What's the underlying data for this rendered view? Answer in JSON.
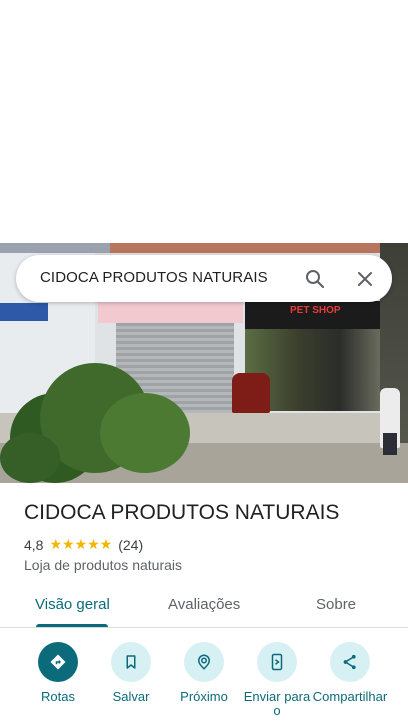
{
  "search": {
    "query": "CIDOCA PRODUTOS NATURAIS"
  },
  "photo": {
    "sign_text": "PET SHOP"
  },
  "place": {
    "title": "CIDOCA PRODUTOS NATURAIS",
    "rating": "4,8",
    "stars": "★★★★★",
    "review_count": "(24)",
    "category": "Loja de produtos naturais"
  },
  "tabs": [
    {
      "label": "Visão geral",
      "active": true
    },
    {
      "label": "Avaliações",
      "active": false
    },
    {
      "label": "Sobre",
      "active": false
    }
  ],
  "actions": [
    {
      "label": "Rotas",
      "icon": "directions-icon"
    },
    {
      "label": "Salvar",
      "icon": "bookmark-icon"
    },
    {
      "label": "Próximo",
      "icon": "nearby-icon"
    },
    {
      "label": "Enviar para o",
      "icon": "send-to-phone-icon"
    },
    {
      "label": "Compartilhar",
      "icon": "share-icon"
    }
  ],
  "colors": {
    "accent": "#0b6b7a",
    "accent_light": "#d7f0f4",
    "star": "#f5b400"
  }
}
